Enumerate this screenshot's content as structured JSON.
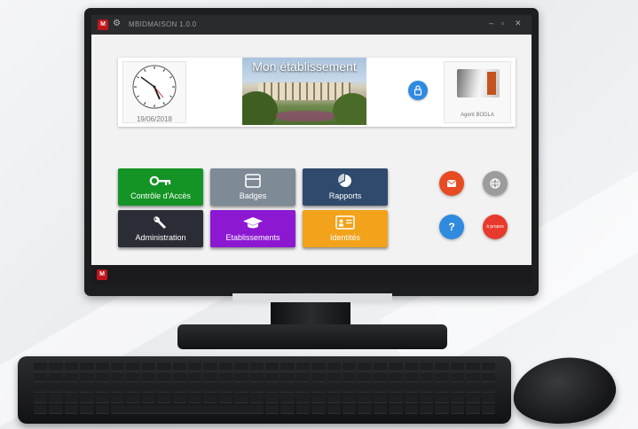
{
  "window": {
    "title": "MBIDMAISON 1.0.0"
  },
  "header": {
    "date": "19/06/2018",
    "etablissement_title": "Mon établissement",
    "agent_name": "Agent BODLA"
  },
  "tiles": [
    {
      "label": "Contrôle d'Accès",
      "icon": "key-icon",
      "color": "#149425"
    },
    {
      "label": "Badges",
      "icon": "badge-card-icon",
      "color": "#7e8a95"
    },
    {
      "label": "Rapports",
      "icon": "pie-chart-icon",
      "color": "#2f4a6c"
    },
    {
      "label": "Administration",
      "icon": "wrench-icon",
      "color": "#2a2d35"
    },
    {
      "label": "Etablissements",
      "icon": "graduation-cap-icon",
      "color": "#8d18d2"
    },
    {
      "label": "Identités",
      "icon": "id-card-icon",
      "color": "#f2a21b"
    }
  ],
  "actions": {
    "mail_color": "#e84a22",
    "web_color": "#9c9c9c",
    "help_label": "?",
    "help_color": "#2f8ae0",
    "about_label": "à propos",
    "about_color": "#e83a2c"
  },
  "colors": {
    "titlebar": "#2a2b2e",
    "lock_button": "#2f8ae0",
    "app_logo": "#c0161d"
  }
}
